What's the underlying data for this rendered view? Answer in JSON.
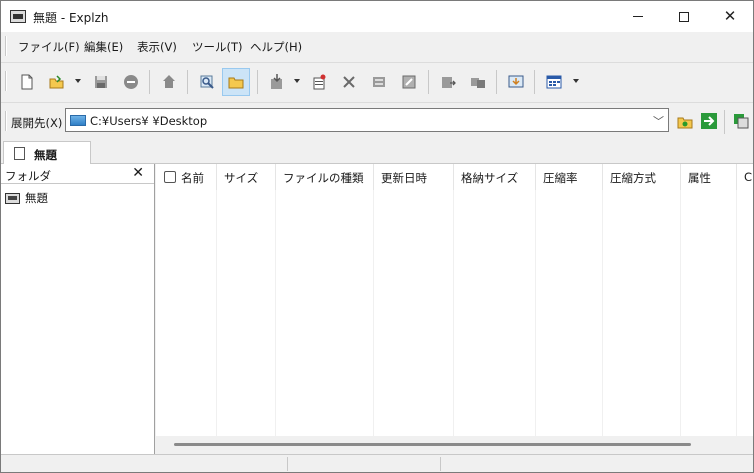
{
  "window": {
    "title": "無題 - Explzh",
    "minimize_icon": "minimize-icon",
    "maximize_icon": "maximize-icon",
    "close_icon": "close-icon"
  },
  "menu": {
    "items": [
      "ファイル(F)",
      "編集(E)",
      "表示(V)",
      "ツール(T)",
      "ヘルプ(H)"
    ]
  },
  "toolbar": {
    "icons": [
      "new-archive-icon",
      "open-icon",
      "save-icon",
      "test-icon",
      "extract-icon",
      "view-icon",
      "folder-icon",
      "add-icon",
      "new-file-icon",
      "delete-icon",
      "convert-icon",
      "repair-icon",
      "split-icon",
      "join-icon",
      "sfx-icon",
      "view-mode-icon"
    ]
  },
  "address": {
    "label": "展開先(X)",
    "path": "C:¥Users¥          ¥Desktop"
  },
  "tab": {
    "label": "無題"
  },
  "folder_panel": {
    "title": "フォルダ",
    "close": "✕",
    "root": "無題"
  },
  "file_list": {
    "columns": [
      "名前",
      "サイズ",
      "ファイルの種類",
      "更新日時",
      "格納サイズ",
      "圧縮率",
      "圧縮方式",
      "属性",
      "C"
    ]
  },
  "colors": {
    "active_button": "#cce4f7",
    "accent": "#0078d4"
  }
}
